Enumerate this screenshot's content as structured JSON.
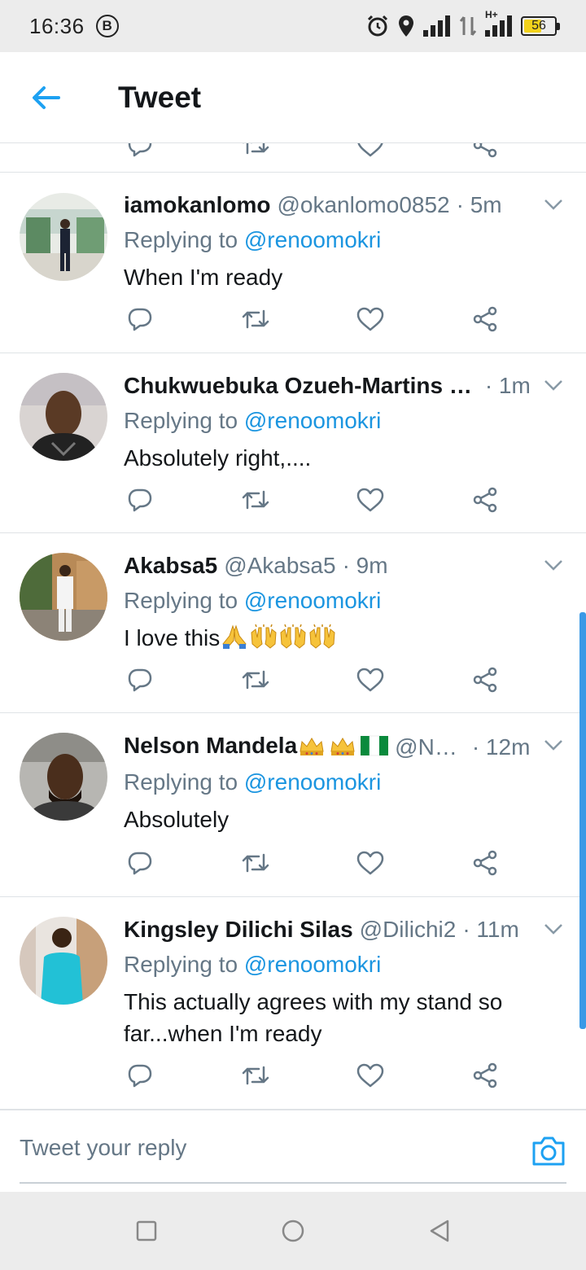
{
  "status_bar": {
    "time": "16:36",
    "b_label": "B",
    "battery_level": "56",
    "network_label": "H+"
  },
  "header": {
    "title": "Tweet"
  },
  "replying_label": "Replying to",
  "tweets": [
    {
      "name": "iamokanlomo",
      "handle": "@okanlomo0852",
      "time": "· 5m",
      "mention": "@renoomokri",
      "text": "When I'm ready"
    },
    {
      "name": "Chukwuebuka Ozueh-Martins …",
      "handle": "",
      "time": "· 1m",
      "mention": "@renoomokri",
      "text": "Absolutely right,...."
    },
    {
      "name": "Akabsa5",
      "handle": "@Akabsa5",
      "time": "· 9m",
      "mention": "@renoomokri",
      "text": "I love this"
    },
    {
      "name": "Nelson Mandela",
      "handle": "@N…",
      "time": "· 12m",
      "mention": "@renoomokri",
      "text": "Absolutely"
    },
    {
      "name": "Kingsley Dilichi Silas",
      "handle": "@Dilichi2",
      "time": "· 11m",
      "mention": "@renoomokri",
      "text": "This actually agrees with my stand so far...when I'm ready"
    }
  ],
  "composer": {
    "placeholder": "Tweet your reply"
  },
  "colors": {
    "accent": "#1da1f2",
    "mention": "#1b95e0",
    "secondary_text": "#657786",
    "divider": "#dfe3e6"
  },
  "icons": {
    "back": "arrow-left-icon",
    "reply": "reply-icon",
    "retweet": "retweet-icon",
    "like": "heart-icon",
    "share": "share-icon",
    "more": "chevron-down-icon",
    "camera": "camera-icon"
  }
}
